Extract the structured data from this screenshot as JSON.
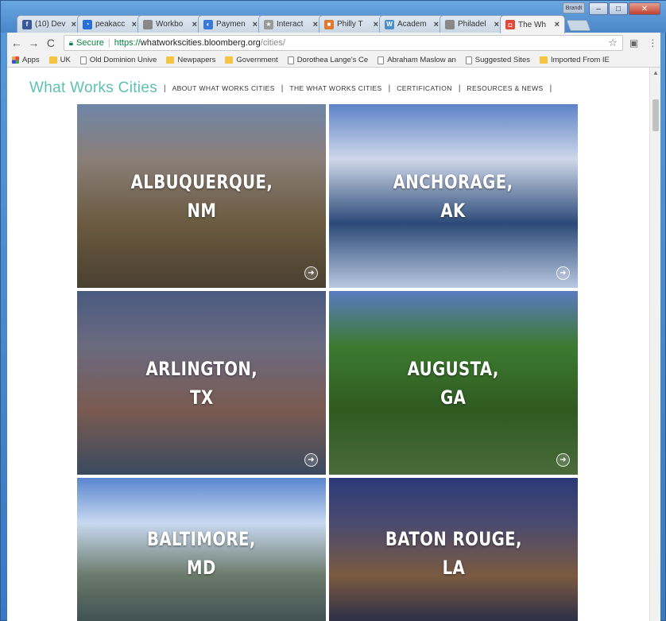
{
  "browser": {
    "tabs": [
      {
        "title": "(10) Dev",
        "fav_color": "#3b5998",
        "fav_letter": "f",
        "active": false
      },
      {
        "title": "peakacc",
        "fav_color": "#2a6fd6",
        "fav_letter": "◔",
        "active": false
      },
      {
        "title": "Workbo",
        "fav_color": "#888888",
        "fav_letter": "",
        "active": false
      },
      {
        "title": "Paymen",
        "fav_color": "#3a7bd5",
        "fav_letter": "◐",
        "active": false
      },
      {
        "title": "Interact",
        "fav_color": "#999999",
        "fav_letter": "★",
        "active": false
      },
      {
        "title": "Philly T",
        "fav_color": "#e07a2e",
        "fav_letter": "■",
        "active": false
      },
      {
        "title": "Academ",
        "fav_color": "#4a90c8",
        "fav_letter": "W",
        "active": false
      },
      {
        "title": "Philadel",
        "fav_color": "#888888",
        "fav_letter": "",
        "active": false
      },
      {
        "title": "The Wh",
        "fav_color": "#e04a3a",
        "fav_letter": "◘",
        "active": true
      }
    ],
    "close_glyph": "×",
    "window_controls": {
      "user": "Brandt",
      "minimize": "–",
      "maximize": "□",
      "close": "✕"
    },
    "nav": {
      "back": "←",
      "forward": "→",
      "reload": "C"
    },
    "address": {
      "secure_label": "Secure",
      "protocol": "https://",
      "host": "whatworkscities.bloomberg.org",
      "path": "/cities/"
    },
    "bookmarks": [
      {
        "label": "Apps",
        "icon": "apps-icon"
      },
      {
        "label": "UK",
        "icon": "folder-icon"
      },
      {
        "label": "Old Dominion Unive",
        "icon": "page-icon"
      },
      {
        "label": "Newpapers",
        "icon": "folder-icon"
      },
      {
        "label": "Government",
        "icon": "folder-icon"
      },
      {
        "label": "Dorothea Lange's Ce",
        "icon": "page-icon"
      },
      {
        "label": "Abraham Maslow an",
        "icon": "page-icon"
      },
      {
        "label": "Suggested Sites",
        "icon": "page-icon"
      },
      {
        "label": "Imported From IE",
        "icon": "folder-icon"
      }
    ]
  },
  "site": {
    "brand": "What Works Cities",
    "nav": [
      "ABOUT WHAT WORKS CITIES",
      "THE WHAT WORKS CITIES",
      "CERTIFICATION",
      "RESOURCES & NEWS"
    ],
    "separator": "|"
  },
  "cities": [
    {
      "line1": "ALBUQUERQUE,",
      "line2": "NM",
      "palette": [
        "#6f86a8",
        "#8a7e78",
        "#6a5a40",
        "#4a4030"
      ]
    },
    {
      "line1": "ANCHORAGE,",
      "line2": "AK",
      "palette": [
        "#5e82c8",
        "#cfd8ea",
        "#2c4a78",
        "#b8c8e0"
      ]
    },
    {
      "line1": "ARLINGTON,",
      "line2": "TX",
      "palette": [
        "#4a5a80",
        "#6a6a80",
        "#7a5a50",
        "#3a4a60"
      ]
    },
    {
      "line1": "AUGUSTA,",
      "line2": "GA",
      "palette": [
        "#5a7ac0",
        "#3c7a30",
        "#2f5a20",
        "#4a6a3a"
      ]
    },
    {
      "line1": "BALTIMORE,",
      "line2": "MD",
      "palette": [
        "#5a86d0",
        "#c8d8f0",
        "#6a7a6a",
        "#3a4a50"
      ]
    },
    {
      "line1": "BATON ROUGE,",
      "line2": "LA",
      "palette": [
        "#2a3a78",
        "#4a4a70",
        "#7a5a40",
        "#20284a"
      ]
    }
  ],
  "go_glyph": "➜"
}
